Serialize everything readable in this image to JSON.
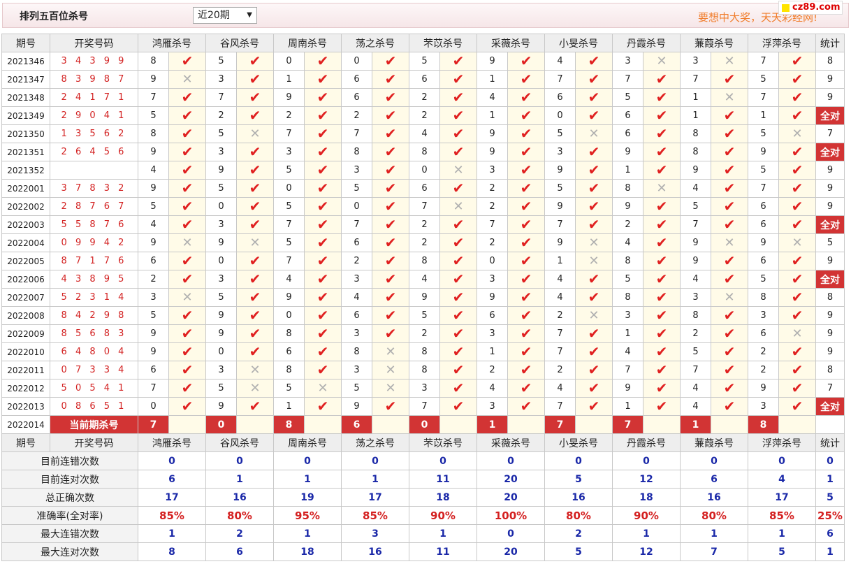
{
  "header": {
    "title": "排列五百位杀号",
    "select_value": "近20期",
    "slogan": "要想中大奖，天天彩经网!",
    "logo_text": "cz89.com"
  },
  "columns": {
    "period": "期号",
    "draw": "开奖号码",
    "experts": [
      "鸿雁杀号",
      "谷风杀号",
      "周南杀号",
      "荡之杀号",
      "芣苡杀号",
      "采薇杀号",
      "小旻杀号",
      "丹霞杀号",
      "蒹葭杀号",
      "浮萍杀号"
    ],
    "stat": "统计"
  },
  "rows": [
    {
      "p": "2021346",
      "d": "3 4 3 9 9",
      "n": [
        8,
        5,
        0,
        0,
        5,
        9,
        4,
        3,
        3,
        7
      ],
      "r": [
        1,
        1,
        1,
        1,
        1,
        1,
        1,
        0,
        0,
        1
      ],
      "s": "8"
    },
    {
      "p": "2021347",
      "d": "8 3 9 8 7",
      "n": [
        9,
        3,
        1,
        6,
        6,
        1,
        7,
        7,
        7,
        5
      ],
      "r": [
        0,
        1,
        1,
        1,
        1,
        1,
        1,
        1,
        1,
        1
      ],
      "s": "9"
    },
    {
      "p": "2021348",
      "d": "2 4 1 7 1",
      "n": [
        7,
        7,
        9,
        6,
        2,
        4,
        6,
        5,
        1,
        7
      ],
      "r": [
        1,
        1,
        1,
        1,
        1,
        1,
        1,
        1,
        0,
        1
      ],
      "s": "9"
    },
    {
      "p": "2021349",
      "d": "2 9 0 4 1",
      "n": [
        5,
        2,
        2,
        2,
        2,
        1,
        0,
        6,
        1,
        1
      ],
      "r": [
        1,
        1,
        1,
        1,
        1,
        1,
        1,
        1,
        1,
        1
      ],
      "s": "全对"
    },
    {
      "p": "2021350",
      "d": "1 3 5 6 2",
      "n": [
        8,
        5,
        7,
        7,
        4,
        9,
        5,
        6,
        8,
        5
      ],
      "r": [
        1,
        0,
        1,
        1,
        1,
        1,
        0,
        1,
        1,
        0
      ],
      "s": "7"
    },
    {
      "p": "2021351",
      "d": "2 6 4 5 6",
      "n": [
        9,
        3,
        3,
        8,
        8,
        9,
        3,
        9,
        8,
        9
      ],
      "r": [
        1,
        1,
        1,
        1,
        1,
        1,
        1,
        1,
        1,
        1
      ],
      "s": "全对"
    },
    {
      "p": "2021352",
      "d": "",
      "n": [
        4,
        9,
        5,
        3,
        0,
        3,
        9,
        1,
        9,
        5
      ],
      "r": [
        1,
        1,
        1,
        1,
        0,
        1,
        1,
        1,
        1,
        1
      ],
      "s": "9"
    },
    {
      "p": "2022001",
      "d": "3 7 8 3 2",
      "n": [
        9,
        5,
        0,
        5,
        6,
        2,
        5,
        8,
        4,
        7
      ],
      "r": [
        1,
        1,
        1,
        1,
        1,
        1,
        1,
        0,
        1,
        1
      ],
      "s": "9"
    },
    {
      "p": "2022002",
      "d": "2 8 7 6 7",
      "n": [
        5,
        0,
        5,
        0,
        7,
        2,
        9,
        9,
        5,
        6
      ],
      "r": [
        1,
        1,
        1,
        1,
        0,
        1,
        1,
        1,
        1,
        1
      ],
      "s": "9"
    },
    {
      "p": "2022003",
      "d": "5 5 8 7 6",
      "n": [
        4,
        3,
        7,
        7,
        2,
        7,
        7,
        2,
        7,
        6
      ],
      "r": [
        1,
        1,
        1,
        1,
        1,
        1,
        1,
        1,
        1,
        1
      ],
      "s": "全对"
    },
    {
      "p": "2022004",
      "d": "0 9 9 4 2",
      "n": [
        9,
        9,
        5,
        6,
        2,
        2,
        9,
        4,
        9,
        9
      ],
      "r": [
        0,
        0,
        1,
        1,
        1,
        1,
        0,
        1,
        0,
        0
      ],
      "s": "5"
    },
    {
      "p": "2022005",
      "d": "8 7 1 7 6",
      "n": [
        6,
        0,
        7,
        2,
        8,
        0,
        1,
        8,
        9,
        6
      ],
      "r": [
        1,
        1,
        1,
        1,
        1,
        1,
        0,
        1,
        1,
        1
      ],
      "s": "9"
    },
    {
      "p": "2022006",
      "d": "4 3 8 9 5",
      "n": [
        2,
        3,
        4,
        3,
        4,
        3,
        4,
        5,
        4,
        5
      ],
      "r": [
        1,
        1,
        1,
        1,
        1,
        1,
        1,
        1,
        1,
        1
      ],
      "s": "全对"
    },
    {
      "p": "2022007",
      "d": "5 2 3 1 4",
      "n": [
        3,
        5,
        9,
        4,
        9,
        9,
        4,
        8,
        3,
        8
      ],
      "r": [
        0,
        1,
        1,
        1,
        1,
        1,
        1,
        1,
        0,
        1
      ],
      "s": "8"
    },
    {
      "p": "2022008",
      "d": "8 4 2 9 8",
      "n": [
        5,
        9,
        0,
        6,
        5,
        6,
        2,
        3,
        8,
        3
      ],
      "r": [
        1,
        1,
        1,
        1,
        1,
        1,
        0,
        1,
        1,
        1
      ],
      "s": "9"
    },
    {
      "p": "2022009",
      "d": "8 5 6 8 3",
      "n": [
        9,
        9,
        8,
        3,
        2,
        3,
        7,
        1,
        2,
        6
      ],
      "r": [
        1,
        1,
        1,
        1,
        1,
        1,
        1,
        1,
        1,
        0
      ],
      "s": "9"
    },
    {
      "p": "2022010",
      "d": "6 4 8 0 4",
      "n": [
        9,
        0,
        6,
        8,
        8,
        1,
        7,
        4,
        5,
        2
      ],
      "r": [
        1,
        1,
        1,
        0,
        1,
        1,
        1,
        1,
        1,
        1
      ],
      "s": "9"
    },
    {
      "p": "2022011",
      "d": "0 7 3 3 4",
      "n": [
        6,
        3,
        8,
        3,
        8,
        2,
        2,
        7,
        7,
        2
      ],
      "r": [
        1,
        0,
        1,
        0,
        1,
        1,
        1,
        1,
        1,
        1
      ],
      "s": "8"
    },
    {
      "p": "2022012",
      "d": "5 0 5 4 1",
      "n": [
        7,
        5,
        5,
        5,
        3,
        4,
        4,
        9,
        4,
        9
      ],
      "r": [
        1,
        0,
        0,
        0,
        1,
        1,
        1,
        1,
        1,
        1
      ],
      "s": "7"
    },
    {
      "p": "2022013",
      "d": "0 8 6 5 1",
      "n": [
        0,
        9,
        1,
        9,
        7,
        3,
        7,
        1,
        4,
        3
      ],
      "r": [
        1,
        1,
        1,
        1,
        1,
        1,
        1,
        1,
        1,
        1
      ],
      "s": "全对"
    }
  ],
  "current": {
    "p": "2022014",
    "label": "当前期杀号",
    "n": [
      7,
      0,
      8,
      6,
      0,
      1,
      7,
      7,
      1,
      8
    ]
  },
  "summary": [
    {
      "label": "目前连错次数",
      "v": [
        "0",
        "0",
        "0",
        "0",
        "0",
        "0",
        "0",
        "0",
        "0",
        "0"
      ],
      "s": "0",
      "pct": false
    },
    {
      "label": "目前连对次数",
      "v": [
        "6",
        "1",
        "1",
        "1",
        "11",
        "20",
        "5",
        "12",
        "6",
        "4"
      ],
      "s": "1",
      "pct": false
    },
    {
      "label": "总正确次数",
      "v": [
        "17",
        "16",
        "19",
        "17",
        "18",
        "20",
        "16",
        "18",
        "16",
        "17"
      ],
      "s": "5",
      "pct": false
    },
    {
      "label": "准确率(全对率)",
      "v": [
        "85%",
        "80%",
        "95%",
        "85%",
        "90%",
        "100%",
        "80%",
        "90%",
        "80%",
        "85%"
      ],
      "s": "25%",
      "pct": true
    },
    {
      "label": "最大连错次数",
      "v": [
        "1",
        "2",
        "1",
        "3",
        "1",
        "0",
        "2",
        "1",
        "1",
        "1"
      ],
      "s": "6",
      "pct": false
    },
    {
      "label": "最大连对次数",
      "v": [
        "8",
        "6",
        "18",
        "16",
        "11",
        "20",
        "5",
        "12",
        "7",
        "5"
      ],
      "s": "1",
      "pct": false
    }
  ],
  "icons": {
    "ok": "check-icon",
    "bad": "cross-icon"
  },
  "colors": {
    "accent_red": "#d23434",
    "blue_value": "#1a28a8",
    "slogan": "#f07d2c"
  }
}
